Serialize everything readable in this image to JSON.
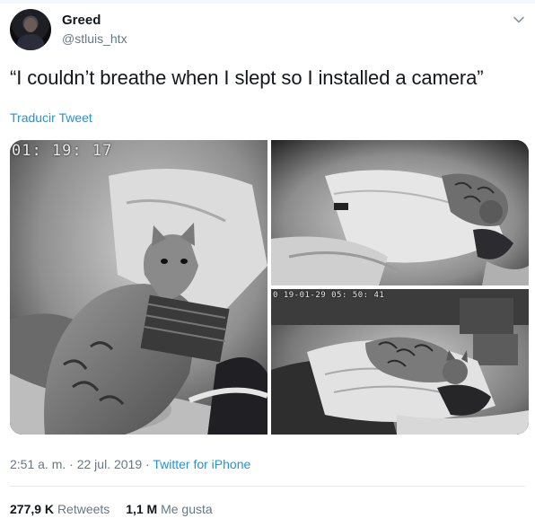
{
  "user": {
    "display_name": "Greed",
    "handle": "@stluis_htx"
  },
  "tweet": {
    "text": "“I couldn’t breathe when I slept so I installed a camera”",
    "translate_label": "Traducir Tweet"
  },
  "media": {
    "photo1_timestamp": "01: 19: 17",
    "photo3_timestamp": "0 19-01-29  05: 50: 41"
  },
  "meta": {
    "time": "2:51 a. m.",
    "separator1": "·",
    "date": "22 jul. 2019",
    "separator2": "·",
    "source": "Twitter for iPhone"
  },
  "stats": {
    "retweets_count": "277,9 K",
    "retweets_label": "Retweets",
    "likes_count": "1,1 M",
    "likes_label": "Me gusta"
  },
  "colors": {
    "link": "#1b95e0",
    "secondary_text": "#657786",
    "primary_text": "#14171a",
    "divider": "#e6ecf0"
  },
  "icons": {
    "menu": "chevron-down-icon"
  }
}
